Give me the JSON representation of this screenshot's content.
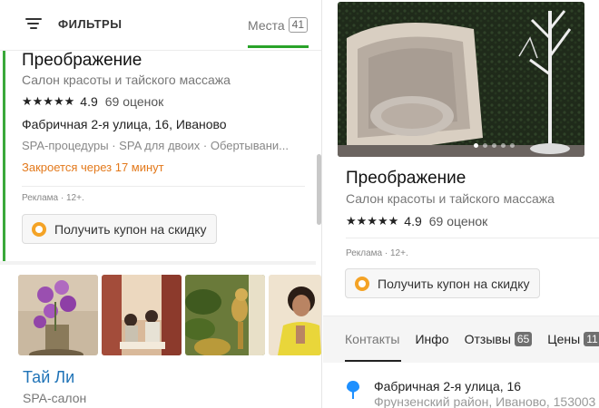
{
  "topbar": {
    "filters_label": "ФИЛЬТРЫ",
    "places_tab_label": "Места",
    "places_count": "41"
  },
  "card1": {
    "title": "Преображение",
    "subtitle": "Салон красоты и тайского массажа",
    "stars": "★★★★★",
    "rating": "4.9",
    "ratings_count": "69 оценок",
    "address": "Фабричная 2-я улица, 16, Иваново",
    "categories": "SPA-процедуры · SPA для двоих · Обертывани...",
    "closing": "Закроется через 17 минут",
    "ad_label": "Реклама · 12+.",
    "coupon_label": "Получить купон на скидку"
  },
  "card2": {
    "title": "Тай Ли",
    "subtitle": "SPA-салон"
  },
  "detail": {
    "title": "Преображение",
    "subtitle": "Салон красоты и тайского массажа",
    "stars": "★★★★★",
    "rating": "4.9",
    "ratings_count": "69 оценок",
    "ad_label": "Реклама · 12+.",
    "coupon_label": "Получить купон на скидку",
    "tabs": [
      {
        "label": "Контакты"
      },
      {
        "label": "Инфо"
      },
      {
        "label": "Отзывы",
        "badge": "65"
      },
      {
        "label": "Цены",
        "badge": "11"
      }
    ],
    "address_line1": "Фабричная 2-я улица, 16",
    "address_line2": "Фрунзенский район, Иваново, 153003"
  },
  "colors": {
    "accent_green": "#3aa83a",
    "link_blue": "#1f73b7",
    "warning_orange": "#e3791b",
    "coupon_icon": "#f4a326",
    "pin_blue": "#1e90ff"
  },
  "icons": {
    "filters": "filter-lines-icon",
    "coupon": "coupon-icon",
    "location": "location-pin-icon"
  }
}
